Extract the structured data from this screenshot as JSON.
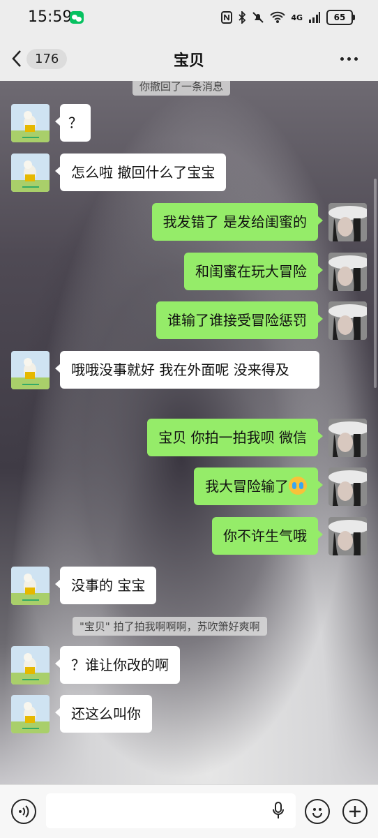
{
  "status_bar": {
    "time": "15:59",
    "network": "4G",
    "battery": "65"
  },
  "header": {
    "back_count": "176",
    "title": "宝贝"
  },
  "system_messages": {
    "recall": "你撤回了一条消息",
    "pat": "\"宝贝\" 拍了拍我啊啊啊，苏吹箫好爽啊"
  },
  "messages": [
    {
      "side": "left",
      "text": "？"
    },
    {
      "side": "left",
      "text": "怎么啦 撤回什么了宝宝"
    },
    {
      "side": "right",
      "text": "我发错了 是发给闺蜜的"
    },
    {
      "side": "right",
      "text": "和闺蜜在玩大冒险"
    },
    {
      "side": "right",
      "text": "谁输了谁接受冒险惩罚"
    },
    {
      "side": "left",
      "text": "哦哦没事就好 我在外面呢 没来得及"
    },
    {
      "side": "right",
      "text": "宝贝 你拍一拍我呗  微信"
    },
    {
      "side": "right",
      "text": "我大冒险输了",
      "emoji": "loudly-crying-face"
    },
    {
      "side": "right",
      "text": "你不许生气哦"
    },
    {
      "side": "left",
      "text": "没事的 宝宝"
    },
    {
      "side": "left",
      "text": "？谁让你改的啊"
    },
    {
      "side": "left",
      "text": "还这么叫你"
    }
  ],
  "colors": {
    "sent_bubble": "#95ec69",
    "received_bubble": "#ffffff",
    "wechat_green": "#07c160"
  }
}
